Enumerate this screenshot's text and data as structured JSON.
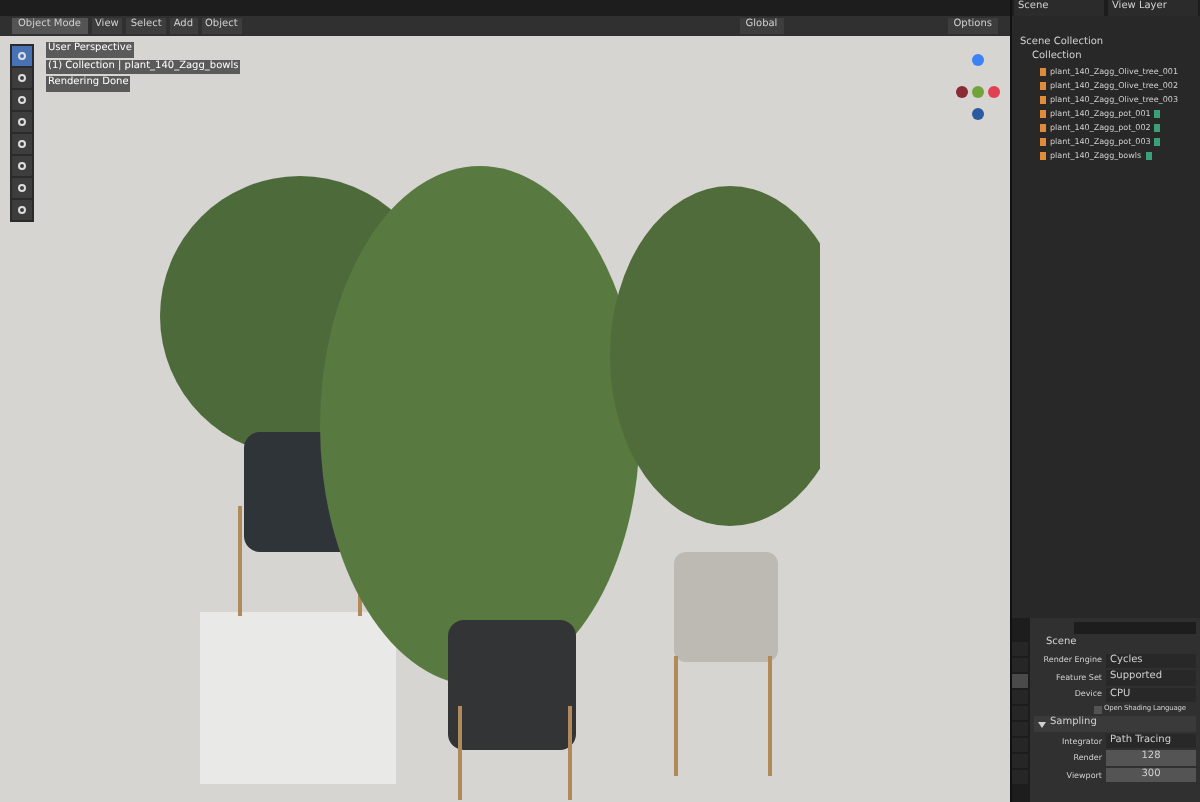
{
  "top_bar": {
    "scene": "Scene",
    "view_layer": "View Layer"
  },
  "viewport": {
    "mode": "Object Mode",
    "menus": [
      "View",
      "Select",
      "Add",
      "Object"
    ],
    "orientation": "Global",
    "options": "Options",
    "overlay_lines": [
      "User Perspective",
      "(1) Collection | plant_140_Zagg_bowls",
      "Rendering Done"
    ],
    "tools": [
      {
        "selected": true
      },
      {
        "selected": false
      },
      {
        "selected": false
      },
      {
        "selected": false
      },
      {
        "selected": false
      },
      {
        "selected": false
      },
      {
        "selected": false
      },
      {
        "selected": false
      }
    ]
  },
  "outliner": {
    "root": "Scene Collection",
    "collection": "Collection",
    "items": [
      {
        "name": "plant_140_Zagg_Olive_tree_001",
        "kind": "tree"
      },
      {
        "name": "plant_140_Zagg_Olive_tree_002",
        "kind": "tree"
      },
      {
        "name": "plant_140_Zagg_Olive_tree_003",
        "kind": "tree"
      },
      {
        "name": "plant_140_Zagg_pot_001",
        "kind": "pot"
      },
      {
        "name": "plant_140_Zagg_pot_002",
        "kind": "pot"
      },
      {
        "name": "plant_140_Zagg_pot_003",
        "kind": "pot"
      },
      {
        "name": "plant_140_Zagg_bowls",
        "kind": "pot"
      }
    ]
  },
  "properties": {
    "title": "Scene",
    "fields": [
      {
        "label": "Render Engine",
        "value": "Cycles"
      },
      {
        "label": "Feature Set",
        "value": "Supported"
      },
      {
        "label": "Device",
        "value": "CPU"
      }
    ],
    "checkbox": {
      "label": "Open Shading Language",
      "checked": false
    },
    "section": {
      "title": "Sampling",
      "expanded": true
    },
    "integrator": {
      "label": "Integrator",
      "value": "Path Tracing"
    },
    "samples": [
      {
        "label": "Render",
        "value": "128"
      },
      {
        "label": "Viewport",
        "value": "300"
      }
    ],
    "tabs": [
      {
        "selected": false
      },
      {
        "selected": false
      },
      {
        "selected": true
      },
      {
        "selected": false
      },
      {
        "selected": false
      },
      {
        "selected": false
      },
      {
        "selected": false
      },
      {
        "selected": false
      },
      {
        "selected": false
      }
    ]
  }
}
